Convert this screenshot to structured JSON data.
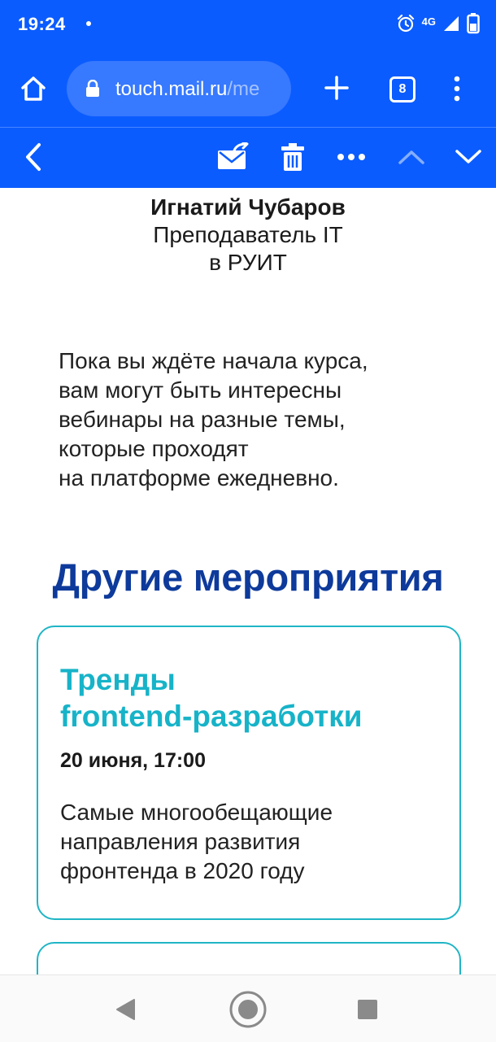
{
  "status_bar": {
    "time": "19:24",
    "network": "4G",
    "icons": [
      "alarm-icon",
      "signal-icon",
      "battery-icon"
    ]
  },
  "browser": {
    "url_main": "touch.mail.ru",
    "url_rest": "/me",
    "tab_count": "8",
    "icons": [
      "home-icon",
      "lock-icon",
      "plus-icon",
      "tabs-icon",
      "kebab-menu-icon"
    ]
  },
  "mail_toolbar": {
    "icons": [
      "back-chevron-icon",
      "reply-envelope-icon",
      "trash-icon",
      "more-dots-icon",
      "prev-chevron-icon",
      "next-chevron-icon"
    ]
  },
  "signature": {
    "name": "Игнатий Чубаров",
    "role_line1": "Преподаватель IT",
    "role_line2": "в РУИТ"
  },
  "intro": {
    "lines": [
      "Пока вы ждёте начала курса,",
      "вам могут быть интересны",
      "вебинары на разные темы,",
      "которые проходят",
      "на платформе ежедневно."
    ]
  },
  "section": {
    "title": "Другие мероприятия"
  },
  "events": [
    {
      "title_line1": "Тренды",
      "title_line2": "frontend-разработки",
      "date": "20 июня, 17:00",
      "desc_lines": [
        "Самые многообещающие",
        "направления развития",
        "фронтенда в 2020 году"
      ]
    }
  ],
  "colors": {
    "primary_blue": "#0b5cff",
    "heading_navy": "#0d3a9b",
    "accent_teal": "#17b3c8"
  },
  "nav_bar": {
    "icons": [
      "back-triangle-icon",
      "home-circle-icon",
      "recents-square-icon"
    ]
  }
}
